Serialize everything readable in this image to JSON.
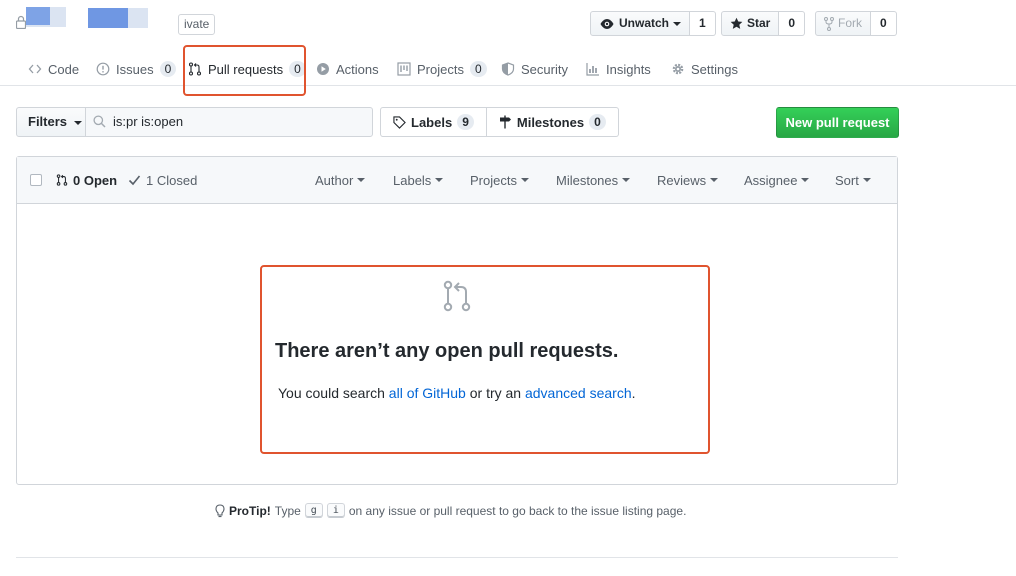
{
  "header": {
    "repo_visibility": "ivate",
    "watch": {
      "label": "Unwatch",
      "count": "1"
    },
    "star": {
      "label": "Star",
      "count": "0"
    },
    "fork": {
      "label": "Fork",
      "count": "0"
    }
  },
  "nav": {
    "tabs": [
      {
        "label": "Code",
        "icon": "code-icon"
      },
      {
        "label": "Issues",
        "count": "0",
        "icon": "issue-icon"
      },
      {
        "label": "Pull requests",
        "count": "0",
        "icon": "pull-request-icon",
        "selected": true
      },
      {
        "label": "Actions",
        "icon": "play-icon"
      },
      {
        "label": "Projects",
        "count": "0",
        "icon": "project-icon"
      },
      {
        "label": "Security",
        "icon": "shield-icon"
      },
      {
        "label": "Insights",
        "icon": "graph-icon"
      },
      {
        "label": "Settings",
        "icon": "gear-icon"
      }
    ]
  },
  "toolbar": {
    "filters_label": "Filters",
    "search_value": "is:pr is:open",
    "labels": {
      "label": "Labels",
      "count": "9"
    },
    "milestones": {
      "label": "Milestones",
      "count": "0"
    },
    "new_pr_label": "New pull request"
  },
  "list_header": {
    "open": "0 Open",
    "closed": "1 Closed",
    "filters": [
      "Author",
      "Labels",
      "Projects",
      "Milestones",
      "Reviews",
      "Assignee",
      "Sort"
    ]
  },
  "blankslate": {
    "title": "There aren’t any open pull requests.",
    "text_before": "You could search ",
    "link1": "all of GitHub",
    "text_middle": " or try an ",
    "link2": "advanced search",
    "text_after": "."
  },
  "protip": {
    "label": "ProTip!",
    "type_word": "Type",
    "key1": "g",
    "key2": "i",
    "rest": "on any issue or pull request to go back to the issue listing page."
  },
  "colors": {
    "accent": "#0366d6",
    "highlight": "#e0542f",
    "primary_button": "#28a745"
  }
}
